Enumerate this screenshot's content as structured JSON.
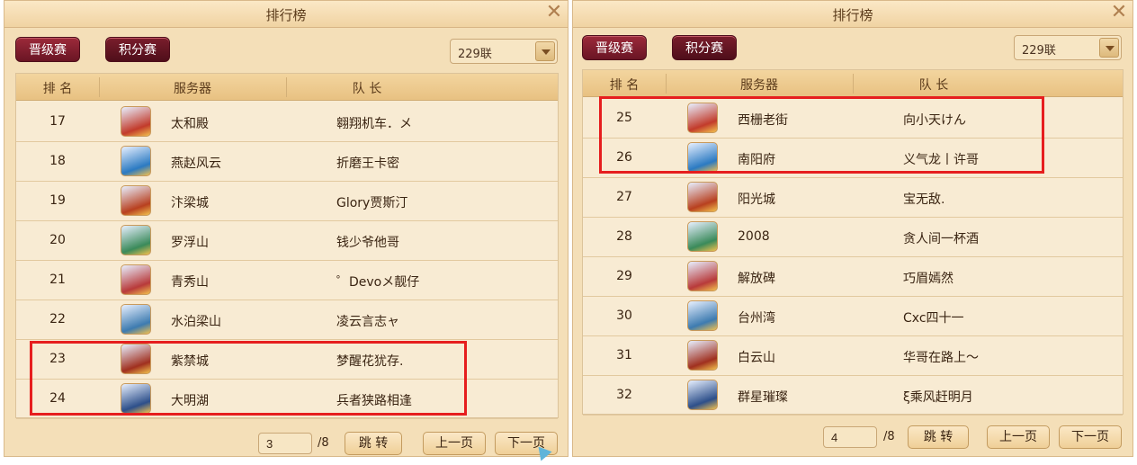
{
  "left": {
    "title": "排行榜",
    "tabs": [
      "晋级赛",
      "积分赛"
    ],
    "server_select": "229联",
    "headers": [
      "排 名",
      "服务器",
      "队 长"
    ],
    "rows": [
      {
        "rank": "17",
        "server": "太和殿",
        "captain": "翱翔机车．メ",
        "icon": "palace-icon"
      },
      {
        "rank": "18",
        "server": "燕赵风云",
        "captain": "折磨王卡密",
        "icon": "dream-icon"
      },
      {
        "rank": "19",
        "server": "汴梁城",
        "captain": "Glory贾斯汀",
        "icon": "gate-icon"
      },
      {
        "rank": "20",
        "server": "罗浮山",
        "captain": "钱少爷他哥",
        "icon": "mountain-icon"
      },
      {
        "rank": "21",
        "server": "青秀山",
        "captain": "゜Devoメ靓仔",
        "icon": "temple-icon"
      },
      {
        "rank": "22",
        "server": "水泊梁山",
        "captain": "凌云言志ャ",
        "icon": "shrine-icon"
      },
      {
        "rank": "23",
        "server": "紫禁城",
        "captain": "梦醒花犹存.",
        "icon": "forbidden-city-icon"
      },
      {
        "rank": "24",
        "server": "大明湖",
        "captain": "兵者狭路相逢",
        "icon": "lake-icon"
      }
    ],
    "page": "3",
    "page_total": "/8",
    "jump": "跳 转",
    "prev": "上一页",
    "next": "下一页"
  },
  "right": {
    "title": "排行榜",
    "tabs": [
      "晋级赛",
      "积分赛"
    ],
    "server_select": "229联",
    "headers": [
      "排 名",
      "服务器",
      "队 长"
    ],
    "rows": [
      {
        "rank": "25",
        "server": "西栅老街",
        "captain": "向小天けん",
        "icon": "street-icon"
      },
      {
        "rank": "26",
        "server": "南阳府",
        "captain": "义气龙丨许哥",
        "icon": "mansion-icon"
      },
      {
        "rank": "27",
        "server": "阳光城",
        "captain": "宝无敌.",
        "icon": "sun-city-icon"
      },
      {
        "rank": "28",
        "server": "2008",
        "captain": "贪人间一杯酒",
        "icon": "festival-icon"
      },
      {
        "rank": "29",
        "server": "解放碑",
        "captain": "巧眉嫣然",
        "icon": "monument-icon"
      },
      {
        "rank": "30",
        "server": "台州湾",
        "captain": "Cxc四十一",
        "icon": "bay-icon"
      },
      {
        "rank": "31",
        "server": "白云山",
        "captain": "华哥在路上～",
        "icon": "cloud-mountain-icon"
      },
      {
        "rank": "32",
        "server": "群星璀璨",
        "captain": "ξ乘风赶明月",
        "icon": "star-icon"
      }
    ],
    "page": "4",
    "page_total": "/8",
    "jump": "跳 转",
    "prev": "上一页",
    "next": "下一页"
  }
}
